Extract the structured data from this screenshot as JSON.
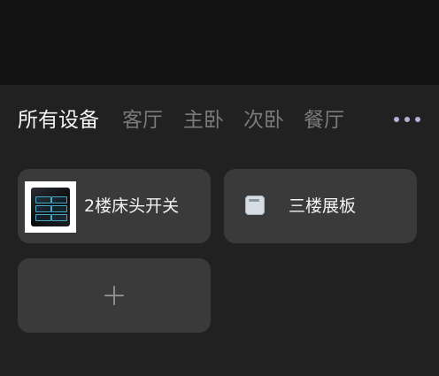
{
  "tabs": [
    {
      "label": "所有设备",
      "active": true
    },
    {
      "label": "客厅",
      "active": false
    },
    {
      "label": "主卧",
      "active": false
    },
    {
      "label": "次卧",
      "active": false
    },
    {
      "label": "餐厅",
      "active": false
    }
  ],
  "more_icon": "more-horizontal-icon",
  "devices": [
    {
      "name": "2楼床头开关",
      "icon": "switch-panel-photo"
    },
    {
      "name": "三楼展板",
      "icon": "panel-icon"
    }
  ],
  "add_device_icon": "plus-icon",
  "colors": {
    "background": "#212121",
    "topbar": "#121212",
    "card": "#3a3a3a",
    "tab_active": "#f4f4f4",
    "tab_inactive": "#7a7a7a",
    "more_dots": "#b7b0d8"
  }
}
